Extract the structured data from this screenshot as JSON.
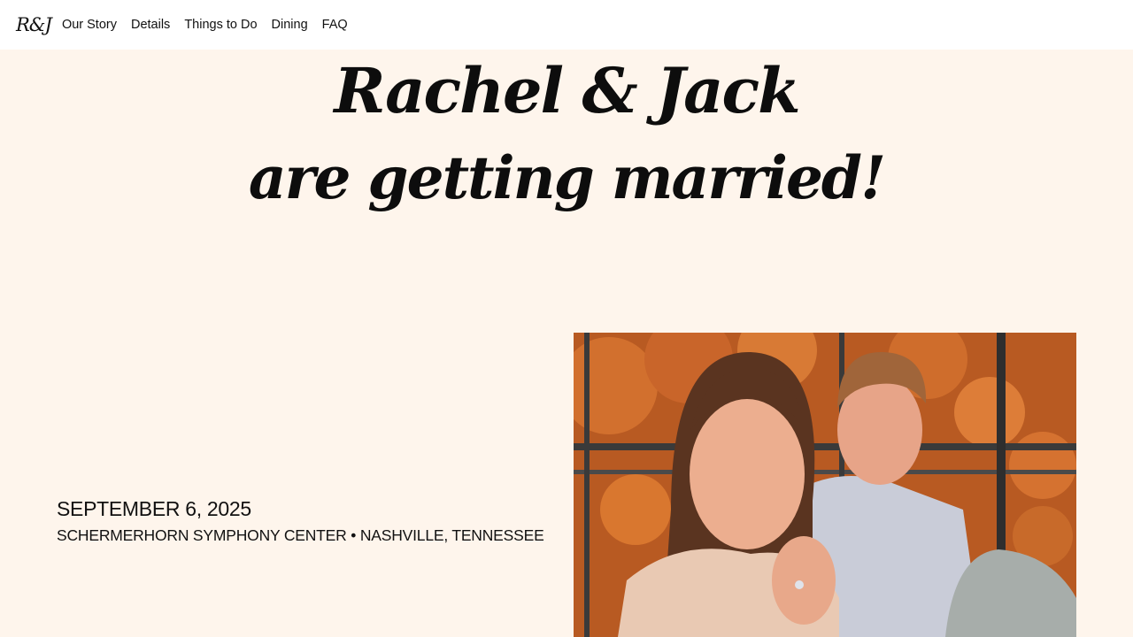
{
  "nav": {
    "logo": "R&J",
    "links": [
      "Our Story",
      "Details",
      "Things to Do",
      "Dining",
      "FAQ"
    ]
  },
  "hero": {
    "line1": "Rachel & Jack",
    "line2": "are getting married!"
  },
  "event": {
    "date": "SEPTEMBER 6, 2025",
    "venue": "SCHERMERHORN SYMPHONY CENTER • NASHVILLE, TENNESSEE"
  },
  "photo": {
    "subject": "engagement-photo"
  },
  "colors": {
    "background": "#fef5ec",
    "nav_background": "#ffffff",
    "text": "#111111"
  }
}
